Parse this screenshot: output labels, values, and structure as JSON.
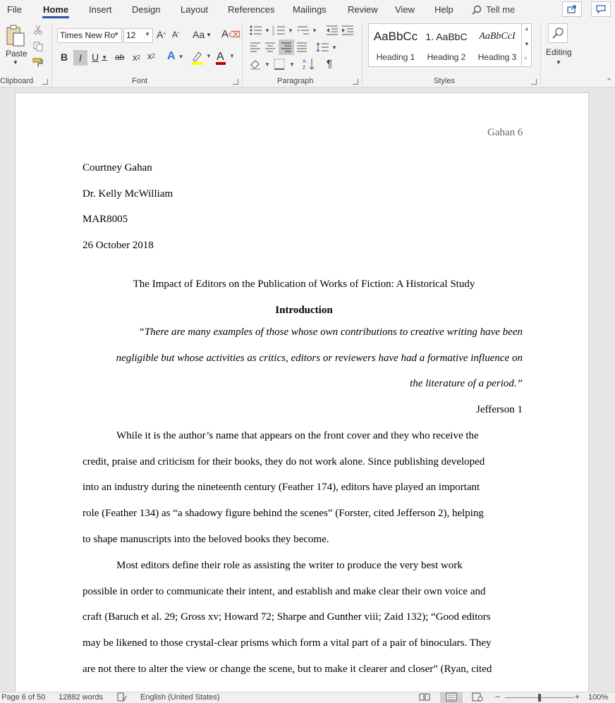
{
  "tabs": [
    "File",
    "Home",
    "Insert",
    "Design",
    "Layout",
    "References",
    "Mailings",
    "Review",
    "View",
    "Help"
  ],
  "tell_me": "Tell me",
  "ribbon": {
    "clipboard": {
      "paste_label": "Paste",
      "group_label": "Clipboard"
    },
    "font": {
      "font_name": "Times New Ro",
      "font_size": "12",
      "group_label": "Font"
    },
    "paragraph": {
      "group_label": "Paragraph"
    },
    "styles": {
      "group_label": "Styles",
      "items": [
        {
          "sample": "AaBbCc",
          "name": "Heading 1"
        },
        {
          "sample": "1.  AaBbC",
          "name": "Heading 2"
        },
        {
          "sample": "AaBbCcI",
          "name": "Heading 3"
        }
      ]
    },
    "editing": {
      "label": "Editing"
    }
  },
  "document": {
    "header_right": "Gahan 6",
    "author": "Courtney Gahan",
    "instructor": "Dr. Kelly McWilliam",
    "course": "MAR8005",
    "date": "26 October 2018",
    "title": "The Impact of Editors on the Publication of Works of Fiction: A Historical Study",
    "heading": "Introduction",
    "quote_lines": [
      "“There are many examples of those whose own contributions to creative writing have been",
      "negligible but whose activities as critics, editors or reviewers have had a formative influence on",
      "the literature of a period.”"
    ],
    "quote_source": "Jefferson 1",
    "para1_lines": [
      "While it is the author’s name that appears on the front cover and they who receive the",
      "credit, praise and criticism for their books, they do not work alone. Since publishing developed",
      "into an industry during the nineteenth century (Feather 174), editors have played an important",
      "role (Feather 134) as “a shadowy figure behind the scenes” (Forster, cited Jefferson 2), helping",
      "to shape manuscripts into the beloved books they become."
    ],
    "para2_lines": [
      "Most editors define their role as assisting the writer to produce the very best work",
      "possible in order to communicate their intent, and establish and make clear their own voice and",
      "craft (Baruch et al. 29; Gross xv; Howard 72; Sharpe and Gunther viii; Zaid 132); “Good editors",
      "may be likened to those crystal-clear prisms which form a vital part of a pair of binoculars. They",
      "are not there to alter the view or change the scene, but to make it clearer and closer” (Ryan, cited"
    ]
  },
  "status": {
    "page": "Page 6 of 50",
    "words": "12882 words",
    "language": "English (United States)",
    "zoom": "100%",
    "zoom_level_percent": 100
  },
  "colors": {
    "accent": "#2b579a",
    "font_color_bar": "#c00000",
    "highlight_bar": "#ffff00"
  }
}
